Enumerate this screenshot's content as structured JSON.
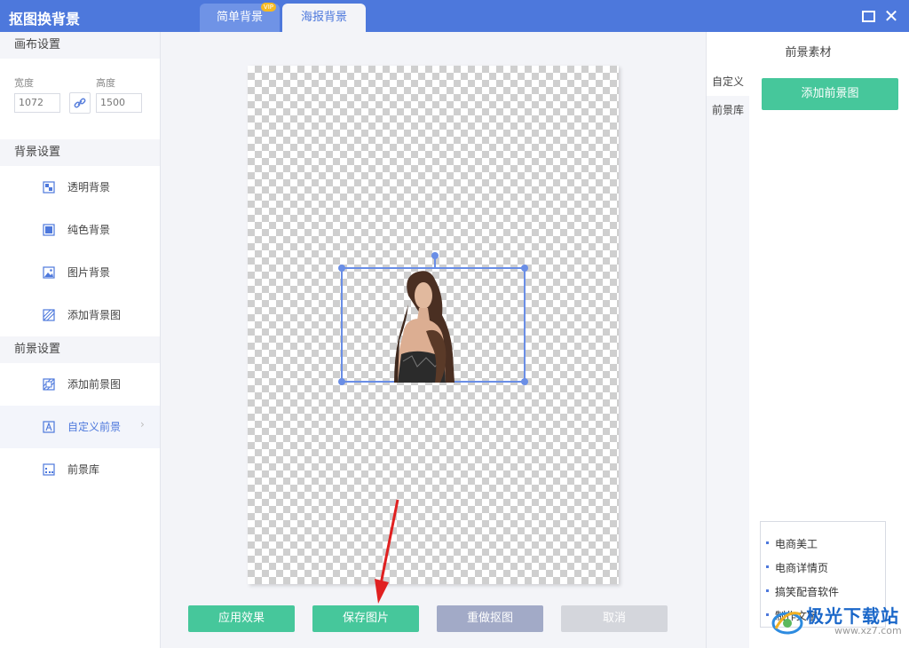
{
  "window": {
    "title": "抠图换背景"
  },
  "tabs": [
    {
      "label": "简单背景",
      "badge": "VIP"
    },
    {
      "label": "海报背景"
    }
  ],
  "canvas_settings": {
    "heading": "画布设置",
    "width_label": "宽度",
    "width_value": "1072",
    "height_label": "高度",
    "height_value": "1500"
  },
  "background_settings": {
    "heading": "背景设置",
    "items": [
      {
        "label": "透明背景",
        "icon": "transparent-bg-icon"
      },
      {
        "label": "纯色背景",
        "icon": "solid-color-icon"
      },
      {
        "label": "图片背景",
        "icon": "image-icon"
      },
      {
        "label": "添加背景图",
        "icon": "add-background-icon"
      }
    ]
  },
  "foreground_settings": {
    "heading": "前景设置",
    "items": [
      {
        "label": "添加前景图",
        "icon": "add-foreground-icon"
      },
      {
        "label": "自定义前景",
        "icon": "text-a-icon",
        "active": true
      },
      {
        "label": "前景库",
        "icon": "library-icon"
      }
    ]
  },
  "actions": {
    "apply": "应用效果",
    "save": "保存图片",
    "redo": "重做抠图",
    "cancel": "取消"
  },
  "right_panel": {
    "title": "前景素材",
    "tabs": [
      "自定义",
      "前景库"
    ],
    "add_button": "添加前景图"
  },
  "ad_links": [
    "电商美工",
    "电商详情页",
    "搞笑配音软件",
    "制作文字"
  ],
  "watermark": {
    "text": "极光下载站",
    "url": "www.xz7.com"
  },
  "colors": {
    "accent": "#4d78dc",
    "green": "#46c79b",
    "redo": "#a2aac7",
    "disabled": "#d4d6dc"
  }
}
